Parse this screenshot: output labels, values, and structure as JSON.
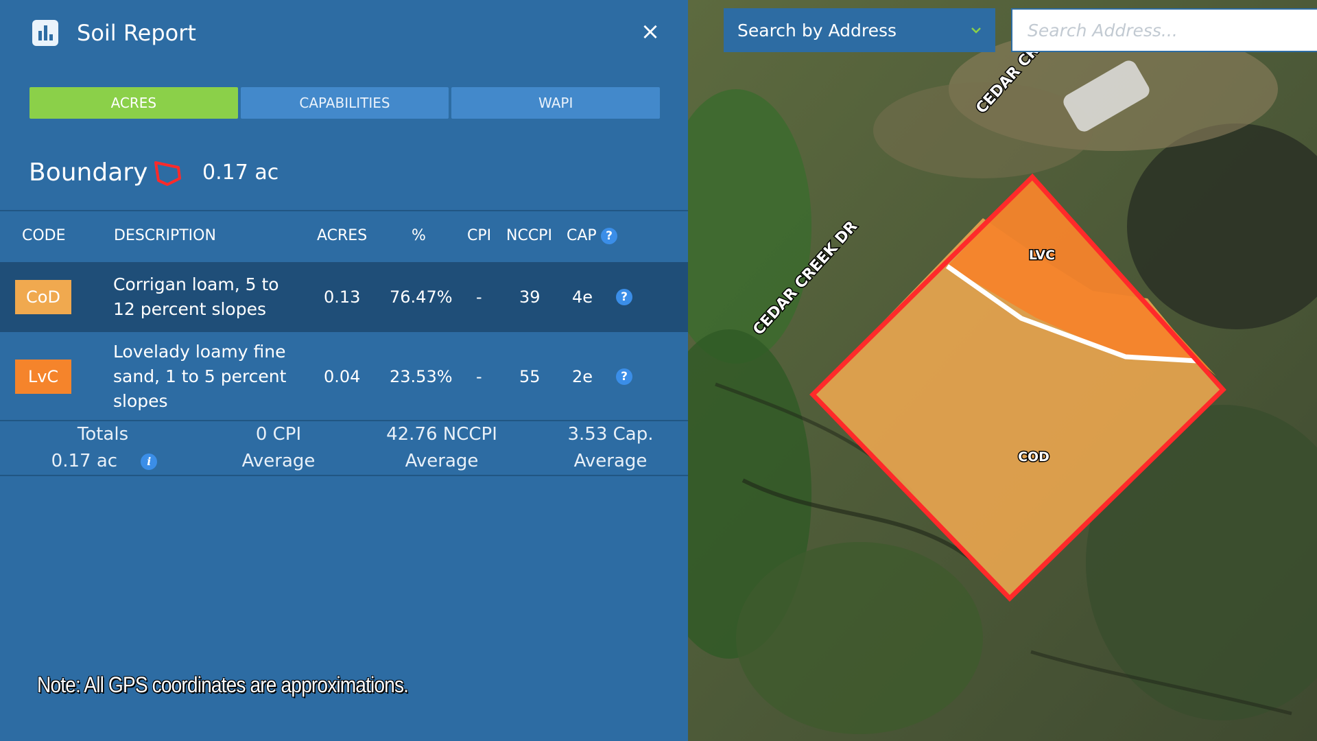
{
  "header": {
    "title": "Soil Report",
    "close_label": "×",
    "icon": "bar-chart-icon"
  },
  "tabs": [
    {
      "label": "ACRES",
      "active": true
    },
    {
      "label": "CAPABILITIES",
      "active": false
    },
    {
      "label": "WAPI",
      "active": false
    }
  ],
  "boundary": {
    "label": "Boundary",
    "value": "0.17 ac",
    "icon": "polygon-icon"
  },
  "table": {
    "headers": {
      "code": "CODE",
      "description": "DESCRIPTION",
      "acres": "ACRES",
      "pct": "%",
      "cpi": "CPI",
      "nccpi": "NCCPI",
      "cap": "CAP"
    },
    "rows": [
      {
        "code": "CoD",
        "code_color": "#f0a94f",
        "description": "Corrigan loam, 5 to 12 percent slopes",
        "acres": "0.13",
        "pct": "76.47%",
        "cpi": "-",
        "nccpi": "39",
        "cap": "4e"
      },
      {
        "code": "LvC",
        "code_color": "#f5842b",
        "description": "Lovelady loamy fine sand, 1 to 5 percent slopes",
        "acres": "0.04",
        "pct": "23.53%",
        "cpi": "-",
        "nccpi": "55",
        "cap": "2e"
      }
    ],
    "totals": {
      "label": "Totals",
      "acres": "0.17 ac",
      "cpi": "0 CPI",
      "cpi_sub": "Average",
      "nccpi": "42.76 NCCPI",
      "nccpi_sub": "Average",
      "cap": "3.53 Cap.",
      "cap_sub": "Average"
    }
  },
  "note": "Note: All GPS coordinates are approximations.",
  "map": {
    "search_mode": "Search by Address",
    "search_placeholder": "Search Address...",
    "streets": [
      "CEDAR CREEK DR",
      "CEDAR CRE"
    ],
    "zones": [
      {
        "label": "LVC",
        "color": "#f5842b"
      },
      {
        "label": "COD",
        "color": "#e3a24e"
      }
    ],
    "boundary_color": "#ff2a2a"
  }
}
